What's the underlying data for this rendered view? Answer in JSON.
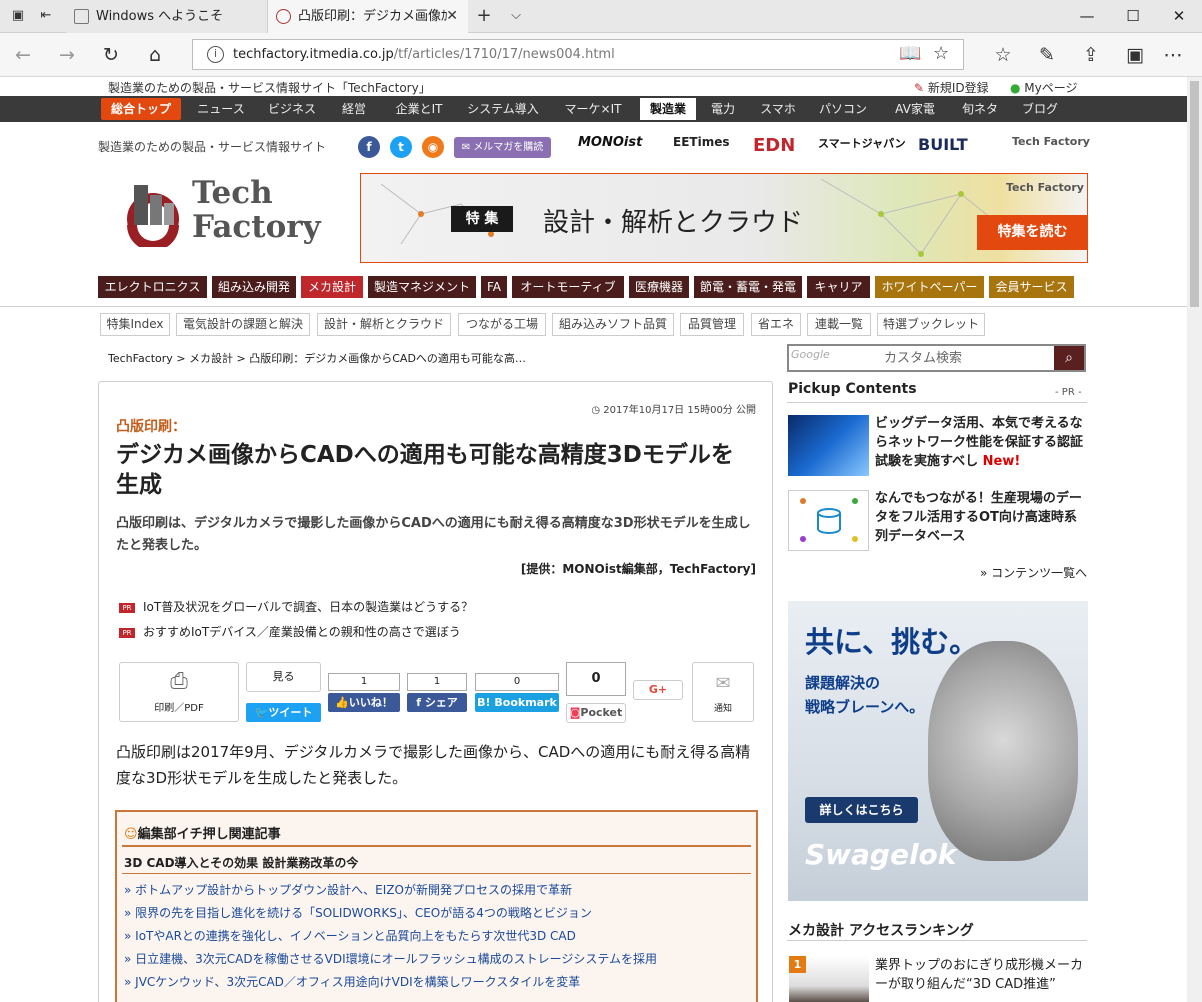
{
  "browser": {
    "tabs": [
      {
        "title": "Windows へようこそ"
      },
      {
        "title": "凸版印刷：デジカメ画像ｶ"
      }
    ],
    "url_host": "techfactory.itmedia.co.jp",
    "url_path": "/tf/articles/1710/17/news004.html"
  },
  "site": {
    "top_desc": "製造業のための製品・サービス情報サイト「TechFactory」",
    "register": "新規ID登録",
    "mypage": "Myページ",
    "tagline": "製造業のための製品・サービス情報サイト",
    "logo_line1": "Tech",
    "logo_line2": "Factory",
    "mailmag": "メルマガを購読",
    "brands": [
      "MONOist",
      "EETimes",
      "EDN",
      "スマートジャパン",
      "BUILT",
      "Tech Factory"
    ]
  },
  "gnav": [
    "総合トップ",
    "ニュース",
    "ビジネス",
    "経営",
    "企業とIT",
    "システム導入",
    "マーケ×IT",
    "製造業",
    "電力",
    "スマホ",
    "パソコン",
    "AV家電",
    "旬ネタ",
    "ブログ"
  ],
  "banner": {
    "label": "特 集",
    "title": "設計・解析とクラウド",
    "button": "特集を読む",
    "logo": "Tech Factory"
  },
  "categories": [
    "エレクトロニクス",
    "組み込み開発",
    "メカ設計",
    "製造マネジメント",
    "FA",
    "オートモーティブ",
    "医療機器",
    "節電・蓄電・発電",
    "キャリア",
    "ホワイトペーパー",
    "会員サービス"
  ],
  "subnav": [
    "特集Index",
    "電気設計の課題と解決",
    "設計・解析とクラウド",
    "つながる工場",
    "組み込みソフト品質",
    "品質管理",
    "省エネ",
    "連載一覧",
    "特選ブックレット"
  ],
  "breadcrumb": "TechFactory > メカ設計 > 凸版印刷：デジカメ画像からCADへの適用も可能な高…",
  "search": {
    "google": "Google",
    "placeholder": "カスタム検索"
  },
  "article": {
    "date": "2017年10月17日 15時00分 公開",
    "kicker": "凸版印刷：",
    "title": "デジカメ画像からCADへの適用も可能な高精度3Dモデルを生成",
    "lead": "凸版印刷は、デジタルカメラで撮影した画像からCADへの適用にも耐え得る高精度な3D形状モデルを生成したと発表した。",
    "credit": "[提供：MONOist編集部，TechFactory]",
    "pr_links": [
      "IoT普及状況をグローバルで調査、日本の製造業はどうする？",
      "おすすめIoTデバイス／産業設備との親和性の高さで選ぼう"
    ],
    "pr_badge": "PR",
    "share": {
      "print": "印刷／PDF",
      "see": "見る",
      "tweet": "ツイート",
      "like_count": "1",
      "like": "いいね！",
      "share_count": "1",
      "share": "シェア",
      "bookmark_count": "0",
      "bookmark": "Bookmark",
      "pocket_count": "0",
      "pocket": "Pocket",
      "gplus": "G+",
      "notify": "通知"
    },
    "body": "凸版印刷は2017年9月、デジタルカメラで撮影した画像から、CADへの適用にも耐え得る高精度な3D形状モデルを生成したと発表した。",
    "related": {
      "heading": "編集部イチ押し関連記事",
      "subheading": "3D CAD導入とその効果 設計業務改革の今",
      "links": [
        "» ボトムアップ設計からトップダウン設計へ、EIZOが新開発プロセスの採用で革新",
        "» 限界の先を目指し進化を続ける「SOLIDWORKS」、CEOが語る4つの戦略とビジョン",
        "» IoTやARとの連携を強化し、イノベーションと品質向上をもたらす次世代3D CAD",
        "» 日立建機、3次元CADを稼働させるVDI環境にオールフラッシュ構成のストレージシステムを採用",
        "» JVCケンウッド、3次元CAD／オフィス用途向けVDIを構築しワークスタイルを変革"
      ]
    }
  },
  "sidebar": {
    "pickup_title": "Pickup Contents",
    "pickup_pr": "- PR -",
    "items": [
      {
        "text": "ビッグデータ活用、本気で考えるならネットワーク性能を保証する認証試験を実施すべし",
        "new": "New!"
      },
      {
        "text": "なんでもつながる！生産現場のデータをフル活用するOT向け高速時系列データベース",
        "new": ""
      }
    ],
    "contents_list": "» コンテンツ一覧へ",
    "ad": {
      "headline": "共に、挑む。",
      "sub1": "課題解決の",
      "sub2": "戦略ブレーンへ。",
      "cta": "詳しくはこちら",
      "brand": "Swagelok"
    },
    "ranking_title": "メカ設計 アクセスランキング",
    "ranking": [
      {
        "rank": "1",
        "text": "業界トップのおにぎり成形機メーカーが取り組んだ“3D CAD推進”"
      }
    ]
  }
}
